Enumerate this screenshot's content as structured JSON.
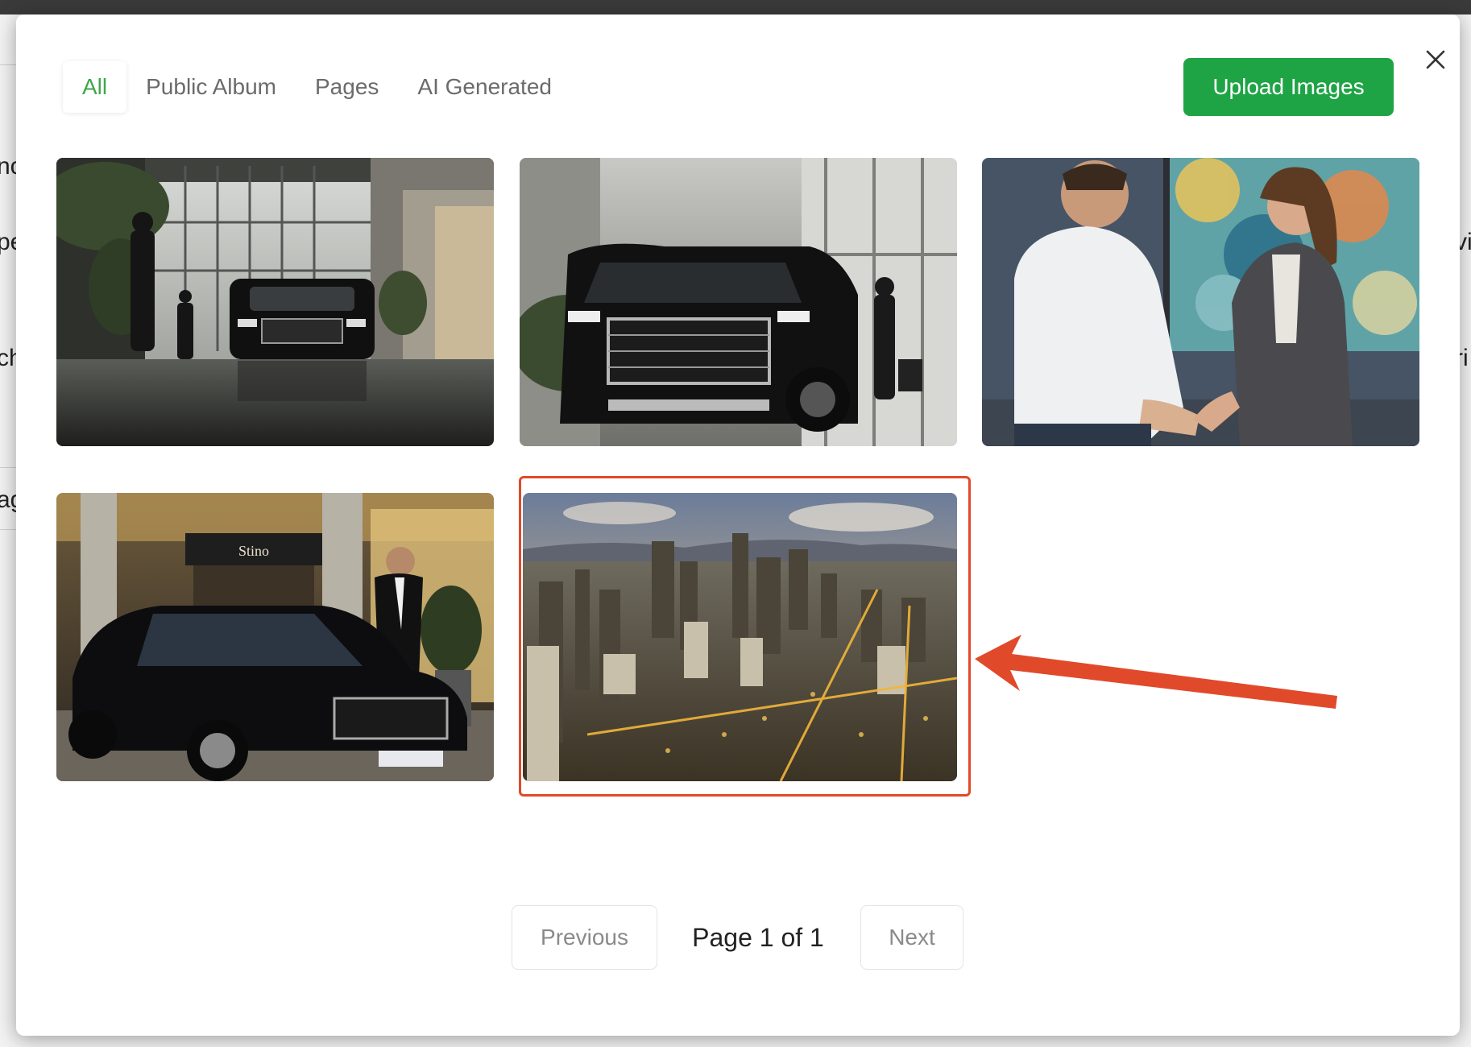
{
  "background_fragments": [
    "nc",
    "pe",
    "ch",
    "ag",
    "vi",
    "ri"
  ],
  "modal": {
    "close_icon": "close-icon",
    "tabs": [
      {
        "label": "All",
        "active": true
      },
      {
        "label": "Public Album",
        "active": false
      },
      {
        "label": "Pages",
        "active": false
      },
      {
        "label": "AI Generated",
        "active": false
      }
    ],
    "upload_button": "Upload Images",
    "images": [
      {
        "name": "hotel-lobby-black-suv",
        "selected": false
      },
      {
        "name": "cadillac-suv-closeup",
        "selected": false
      },
      {
        "name": "business-handshake",
        "selected": false
      },
      {
        "name": "hotel-entrance-mercedes-chauffeur",
        "selected": false,
        "sign_text": "Stino"
      },
      {
        "name": "city-skyline-aerial",
        "selected": true
      }
    ],
    "pagination": {
      "previous": "Previous",
      "status": "Page 1 of 1",
      "next": "Next"
    }
  },
  "colors": {
    "accent_green": "#1fa445",
    "active_tab": "#3fa84a",
    "annotation_red": "#e04a2a"
  }
}
